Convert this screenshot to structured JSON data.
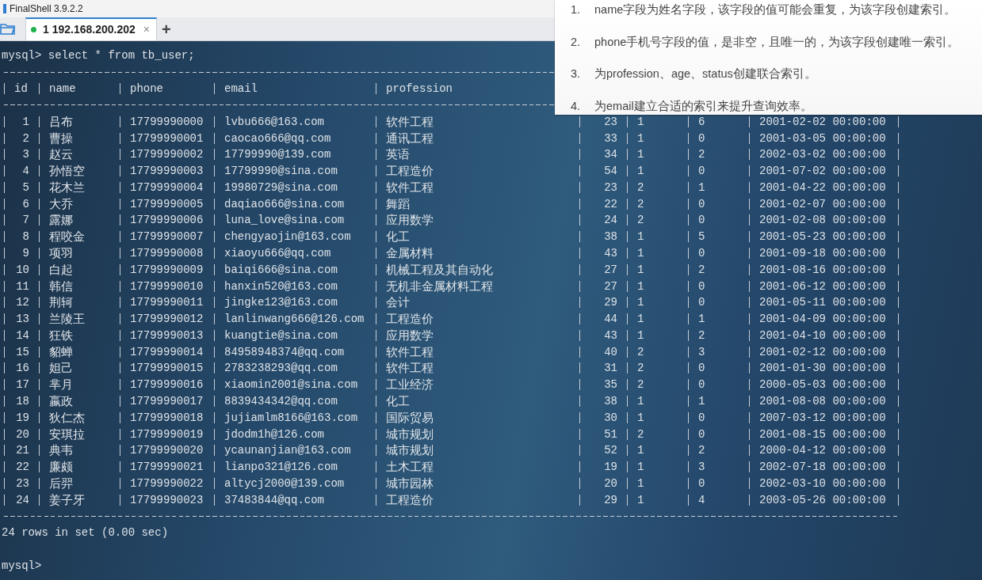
{
  "window": {
    "title": "FinalShell 3.9.2.2"
  },
  "tabs": [
    {
      "number": "1",
      "label": "192.168.200.202",
      "connected": true,
      "selected": true,
      "close_glyph": "×"
    }
  ],
  "new_tab_button": "+",
  "terminal": {
    "prompt": "mysql>",
    "command": "select * from tb_user;",
    "table": {
      "columns": [
        "id",
        "name",
        "phone",
        "email",
        "profession"
      ],
      "rows": [
        [
          "1",
          "吕布",
          "17799990000",
          "lvbu666@163.com",
          "软件工程",
          "23",
          "1",
          "6",
          "2001-02-02 00:00:00"
        ],
        [
          "2",
          "曹操",
          "17799990001",
          "caocao666@qq.com",
          "通讯工程",
          "33",
          "1",
          "0",
          "2001-03-05 00:00:00"
        ],
        [
          "3",
          "赵云",
          "17799990002",
          "17799990@139.com",
          "英语",
          "34",
          "1",
          "2",
          "2002-03-02 00:00:00"
        ],
        [
          "4",
          "孙悟空",
          "17799990003",
          "17799990@sina.com",
          "工程造价",
          "54",
          "1",
          "0",
          "2001-07-02 00:00:00"
        ],
        [
          "5",
          "花木兰",
          "17799990004",
          "19980729@sina.com",
          "软件工程",
          "23",
          "2",
          "1",
          "2001-04-22 00:00:00"
        ],
        [
          "6",
          "大乔",
          "17799990005",
          "daqiao666@sina.com",
          "舞蹈",
          "22",
          "2",
          "0",
          "2001-02-07 00:00:00"
        ],
        [
          "7",
          "露娜",
          "17799990006",
          "luna_love@sina.com",
          "应用数学",
          "24",
          "2",
          "0",
          "2001-02-08 00:00:00"
        ],
        [
          "8",
          "程咬金",
          "17799990007",
          "chengyaojin@163.com",
          "化工",
          "38",
          "1",
          "5",
          "2001-05-23 00:00:00"
        ],
        [
          "9",
          "项羽",
          "17799990008",
          "xiaoyu666@qq.com",
          "金属材料",
          "43",
          "1",
          "0",
          "2001-09-18 00:00:00"
        ],
        [
          "10",
          "白起",
          "17799990009",
          "baiqi666@sina.com",
          "机械工程及其自动化",
          "27",
          "1",
          "2",
          "2001-08-16 00:00:00"
        ],
        [
          "11",
          "韩信",
          "17799990010",
          "hanxin520@163.com",
          "无机非金属材料工程",
          "27",
          "1",
          "0",
          "2001-06-12 00:00:00"
        ],
        [
          "12",
          "荆轲",
          "17799990011",
          "jingke123@163.com",
          "会计",
          "29",
          "1",
          "0",
          "2001-05-11 00:00:00"
        ],
        [
          "13",
          "兰陵王",
          "17799990012",
          "lanlinwang666@126.com",
          "工程造价",
          "44",
          "1",
          "1",
          "2001-04-09 00:00:00"
        ],
        [
          "14",
          "狂铁",
          "17799990013",
          "kuangtie@sina.com",
          "应用数学",
          "43",
          "1",
          "2",
          "2001-04-10 00:00:00"
        ],
        [
          "15",
          "貂蝉",
          "17799990014",
          "84958948374@qq.com",
          "软件工程",
          "40",
          "2",
          "3",
          "2001-02-12 00:00:00"
        ],
        [
          "16",
          "妲己",
          "17799990015",
          "2783238293@qq.com",
          "软件工程",
          "31",
          "2",
          "0",
          "2001-01-30 00:00:00"
        ],
        [
          "17",
          "芈月",
          "17799990016",
          "xiaomin2001@sina.com",
          "工业经济",
          "35",
          "2",
          "0",
          "2000-05-03 00:00:00"
        ],
        [
          "18",
          "嬴政",
          "17799990017",
          "8839434342@qq.com",
          "化工",
          "38",
          "1",
          "1",
          "2001-08-08 00:00:00"
        ],
        [
          "19",
          "狄仁杰",
          "17799990018",
          "jujiamlm8166@163.com",
          "国际贸易",
          "30",
          "1",
          "0",
          "2007-03-12 00:00:00"
        ],
        [
          "20",
          "安琪拉",
          "17799990019",
          "jdodm1h@126.com",
          "城市规划",
          "51",
          "2",
          "0",
          "2001-08-15 00:00:00"
        ],
        [
          "21",
          "典韦",
          "17799990020",
          "ycaunanjian@163.com",
          "城市规划",
          "52",
          "1",
          "2",
          "2000-04-12 00:00:00"
        ],
        [
          "22",
          "廉颇",
          "17799990021",
          "lianpo321@126.com",
          "土木工程",
          "19",
          "1",
          "3",
          "2002-07-18 00:00:00"
        ],
        [
          "23",
          "后羿",
          "17799990022",
          "altycj2000@139.com",
          "城市园林",
          "20",
          "1",
          "0",
          "2002-03-10 00:00:00"
        ],
        [
          "24",
          "姜子牙",
          "17799990023",
          "37483844@qq.com",
          "工程造价",
          "29",
          "1",
          "4",
          "2003-05-26 00:00:00"
        ]
      ]
    },
    "result_summary": "24 rows in set (0.00 sec)",
    "final_prompt": "mysql>"
  },
  "note": {
    "items": [
      {
        "marker": "1.",
        "text": "name字段为姓名字段，该字段的值可能会重复，为该字段创建索引。"
      },
      {
        "marker": "2.",
        "text": "phone手机号字段的值，是非空，且唯一的，为该字段创建唯一索引。"
      },
      {
        "marker": "3.",
        "text": "为profession、age、status创建联合索引。"
      },
      {
        "marker": "4.",
        "text": "为email建立合适的索引来提升查询效率。"
      }
    ]
  }
}
